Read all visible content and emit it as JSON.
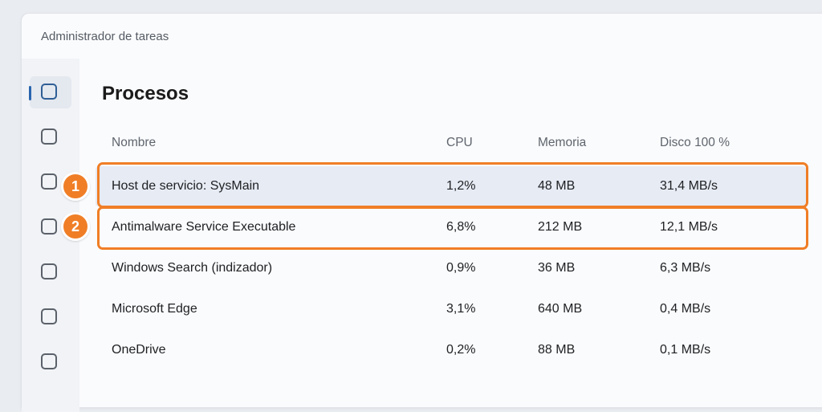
{
  "window": {
    "title": "Administrador de tareas"
  },
  "sidebar": {
    "items": [
      {
        "icon": "square-icon",
        "active": true
      },
      {
        "icon": "square-icon",
        "active": false
      },
      {
        "icon": "square-icon",
        "active": false
      },
      {
        "icon": "square-icon",
        "active": false
      },
      {
        "icon": "square-icon",
        "active": false
      },
      {
        "icon": "square-icon",
        "active": false
      },
      {
        "icon": "square-icon",
        "active": false
      },
      {
        "icon": "square-icon",
        "active": false
      }
    ]
  },
  "main": {
    "heading": "Procesos",
    "columns": {
      "name": "Nombre",
      "cpu": "CPU",
      "memory": "Memoria",
      "disk": "Disco 100 %"
    },
    "rows": [
      {
        "name": "Host de servicio: SysMain",
        "cpu": "1,2%",
        "memory": "48 MB",
        "disk": "31,4 MB/s"
      },
      {
        "name": "Antimalware Service Executable",
        "cpu": "6,8%",
        "memory": "212 MB",
        "disk": "12,1 MB/s"
      },
      {
        "name": "Windows Search (indizador)",
        "cpu": "0,9%",
        "memory": "36 MB",
        "disk": "6,3 MB/s"
      },
      {
        "name": "Microsoft Edge",
        "cpu": "3,1%",
        "memory": "640 MB",
        "disk": "0,4 MB/s"
      },
      {
        "name": "OneDrive",
        "cpu": "0,2%",
        "memory": "88 MB",
        "disk": "0,1 MB/s"
      }
    ]
  },
  "annotations": [
    {
      "label": "1"
    },
    {
      "label": "2"
    }
  ],
  "colors": {
    "accent": "#f07e26",
    "selection": "#e6ebf4",
    "nav_indicator": "#2a64ae"
  }
}
